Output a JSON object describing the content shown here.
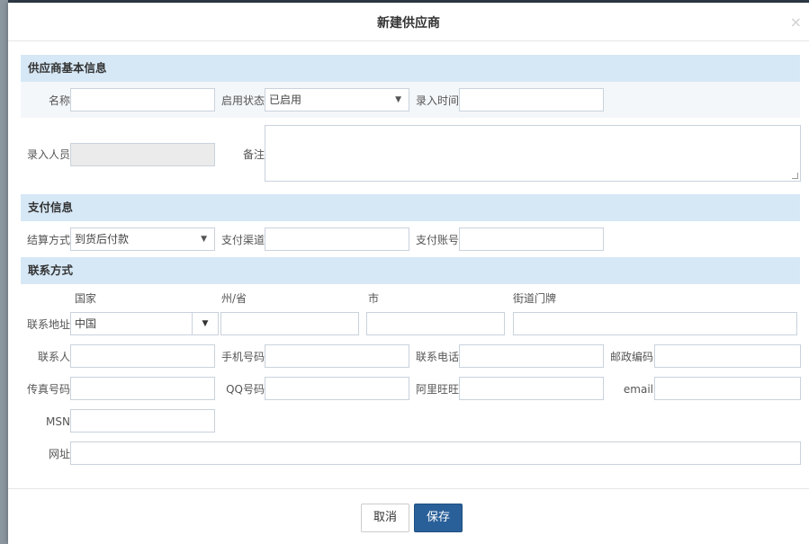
{
  "dialog": {
    "title": "新建供应商",
    "close_glyph": "×"
  },
  "basic": {
    "section_title": "供应商基本信息",
    "name_label": "名称",
    "status_label": "启用状态",
    "status_value": "已启用",
    "entry_time_label": "录入时间",
    "entry_person_label": "录入人员",
    "remark_label": "备注"
  },
  "payment": {
    "section_title": "支付信息",
    "settle_label": "结算方式",
    "settle_value": "到货后付款",
    "channel_label": "支付渠道",
    "account_label": "支付账号"
  },
  "contact": {
    "section_title": "联系方式",
    "col_country": "国家",
    "col_state": "州/省",
    "col_city": "市",
    "col_street": "街道门牌",
    "address_label": "联系地址",
    "country_value": "中国",
    "contact_person_label": "联系人",
    "mobile_label": "手机号码",
    "phone_label": "联系电话",
    "postcode_label": "邮政编码",
    "fax_label": "传真号码",
    "qq_label": "QQ号码",
    "aliwangwang_label": "阿里旺旺",
    "email_label": "email",
    "msn_label": "MSN",
    "website_label": "网址"
  },
  "footer": {
    "cancel_label": "取消",
    "save_label": "保存"
  },
  "icons": {
    "caret": "▼",
    "close": "close-icon",
    "resize": "resize-handle-icon"
  },
  "colors": {
    "section_bg": "#d6e8f6",
    "primary_button": "#2a6099"
  }
}
